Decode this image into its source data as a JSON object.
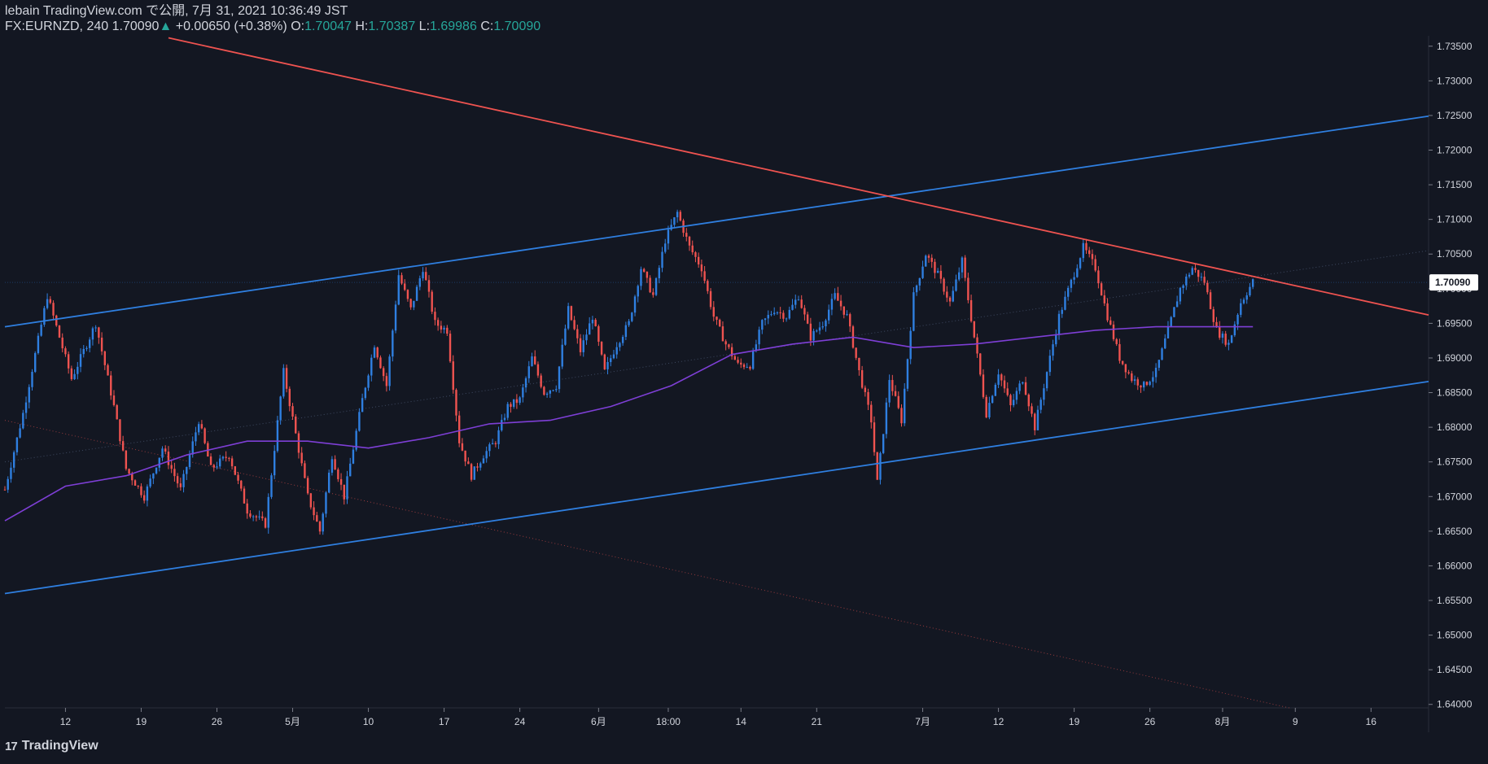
{
  "header": {
    "published": "lebain TradingView.com で公開, 7月 31, 2021 10:36:49 JST",
    "symbol": "FX:EURNZD, 240",
    "last": "1.70090",
    "arrow": "▲",
    "change": "+0.00650 (+0.38%)",
    "o_label": "O:",
    "o_value": "1.70047",
    "h_label": "H:",
    "h_value": "1.70387",
    "l_label": "L:",
    "l_value": "1.69986",
    "c_label": "C:",
    "c_value": "1.70090"
  },
  "footer": {
    "brand": "TradingView"
  },
  "colors": {
    "background": "#131722",
    "up": "#2f7fe0",
    "down": "#ef5350",
    "ma": "#7e3fd6",
    "channel": "#2f7fe0",
    "trend": "#ef5350",
    "price_label_bg": "#ffffff"
  },
  "chart_data": {
    "type": "candlestick",
    "ylim": [
      1.6395,
      1.7365
    ],
    "price_ticks": [
      "1.73500",
      "1.73000",
      "1.72500",
      "1.72000",
      "1.71500",
      "1.71000",
      "1.70500",
      "1.70000",
      "1.69500",
      "1.69000",
      "1.68500",
      "1.68000",
      "1.67500",
      "1.67000",
      "1.66500",
      "1.66000",
      "1.65500",
      "1.65000",
      "1.64500",
      "1.64000"
    ],
    "date_ticks": [
      "12",
      "19",
      "26",
      "5月",
      "10",
      "17",
      "24",
      "6月",
      "18:00",
      "14",
      "21",
      "7月",
      "12",
      "19",
      "26",
      "8月",
      "9",
      "16"
    ],
    "last_price_label": "1.70090",
    "path": [
      [
        0,
        1.671
      ],
      [
        6,
        1.682
      ],
      [
        14,
        1.699
      ],
      [
        22,
        1.687
      ],
      [
        30,
        1.695
      ],
      [
        36,
        1.683
      ],
      [
        40,
        1.674
      ],
      [
        46,
        1.67
      ],
      [
        52,
        1.677
      ],
      [
        58,
        1.671
      ],
      [
        64,
        1.681
      ],
      [
        68,
        1.674
      ],
      [
        74,
        1.676
      ],
      [
        80,
        1.668
      ],
      [
        86,
        1.666
      ],
      [
        92,
        1.688
      ],
      [
        96,
        1.679
      ],
      [
        100,
        1.67
      ],
      [
        104,
        1.665
      ],
      [
        108,
        1.676
      ],
      [
        112,
        1.67
      ],
      [
        118,
        1.684
      ],
      [
        122,
        1.692
      ],
      [
        126,
        1.686
      ],
      [
        130,
        1.702
      ],
      [
        134,
        1.697
      ],
      [
        138,
        1.703
      ],
      [
        142,
        1.695
      ],
      [
        146,
        1.694
      ],
      [
        150,
        1.678
      ],
      [
        154,
        1.673
      ],
      [
        158,
        1.676
      ],
      [
        162,
        1.678
      ],
      [
        166,
        1.683
      ],
      [
        170,
        1.684
      ],
      [
        174,
        1.69
      ],
      [
        178,
        1.685
      ],
      [
        182,
        1.686
      ],
      [
        186,
        1.697
      ],
      [
        190,
        1.691
      ],
      [
        194,
        1.696
      ],
      [
        198,
        1.688
      ],
      [
        202,
        1.692
      ],
      [
        206,
        1.695
      ],
      [
        210,
        1.703
      ],
      [
        214,
        1.699
      ],
      [
        218,
        1.707
      ],
      [
        222,
        1.711
      ],
      [
        226,
        1.706
      ],
      [
        230,
        1.703
      ],
      [
        234,
        1.696
      ],
      [
        238,
        1.692
      ],
      [
        242,
        1.689
      ],
      [
        246,
        1.689
      ],
      [
        250,
        1.695
      ],
      [
        254,
        1.697
      ],
      [
        258,
        1.696
      ],
      [
        262,
        1.699
      ],
      [
        266,
        1.693
      ],
      [
        270,
        1.695
      ],
      [
        274,
        1.699
      ],
      [
        278,
        1.696
      ],
      [
        282,
        1.688
      ],
      [
        286,
        1.681
      ],
      [
        288,
        1.672
      ],
      [
        292,
        1.687
      ],
      [
        296,
        1.681
      ],
      [
        300,
        1.699
      ],
      [
        304,
        1.705
      ],
      [
        308,
        1.702
      ],
      [
        312,
        1.698
      ],
      [
        316,
        1.704
      ],
      [
        320,
        1.693
      ],
      [
        324,
        1.682
      ],
      [
        328,
        1.688
      ],
      [
        332,
        1.683
      ],
      [
        336,
        1.687
      ],
      [
        340,
        1.68
      ],
      [
        344,
        1.688
      ],
      [
        348,
        1.696
      ],
      [
        352,
        1.701
      ],
      [
        356,
        1.706
      ],
      [
        360,
        1.703
      ],
      [
        364,
        1.696
      ],
      [
        368,
        1.69
      ],
      [
        372,
        1.687
      ],
      [
        376,
        1.686
      ],
      [
        380,
        1.688
      ],
      [
        384,
        1.694
      ],
      [
        388,
        1.7
      ],
      [
        392,
        1.703
      ],
      [
        396,
        1.701
      ],
      [
        400,
        1.694
      ],
      [
        404,
        1.692
      ],
      [
        408,
        1.698
      ],
      [
        412,
        1.701
      ]
    ],
    "ma_path": [
      [
        0,
        1.6665
      ],
      [
        20,
        1.6715
      ],
      [
        40,
        1.673
      ],
      [
        60,
        1.676
      ],
      [
        80,
        1.678
      ],
      [
        100,
        1.678
      ],
      [
        120,
        1.677
      ],
      [
        140,
        1.6785
      ],
      [
        160,
        1.6805
      ],
      [
        180,
        1.681
      ],
      [
        200,
        1.683
      ],
      [
        220,
        1.686
      ],
      [
        240,
        1.6905
      ],
      [
        260,
        1.692
      ],
      [
        280,
        1.693
      ],
      [
        300,
        1.6915
      ],
      [
        320,
        1.692
      ],
      [
        340,
        1.693
      ],
      [
        360,
        1.694
      ],
      [
        380,
        1.6945
      ],
      [
        400,
        1.6945
      ],
      [
        412,
        1.6945
      ]
    ]
  }
}
